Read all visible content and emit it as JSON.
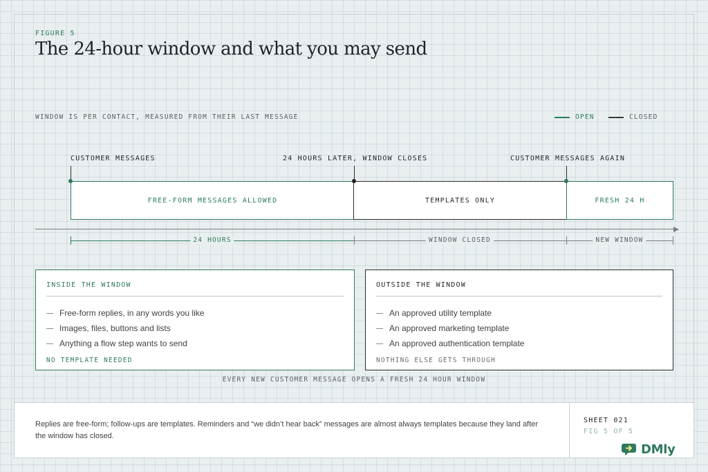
{
  "figure": {
    "label": "FIGURE 5",
    "title": "The 24-hour window and what you may send",
    "subtitle": "WINDOW IS PER CONTACT, MEASURED FROM THEIR LAST MESSAGE"
  },
  "legend": {
    "open": "OPEN",
    "closed": "CLOSED"
  },
  "timeline": {
    "events": [
      "CUSTOMER MESSAGES",
      "24 HOURS LATER, WINDOW CLOSES",
      "CUSTOMER MESSAGES AGAIN"
    ],
    "segments": [
      {
        "label": "FREE-FORM MESSAGES ALLOWED",
        "state": "open"
      },
      {
        "label": "TEMPLATES ONLY",
        "state": "closed"
      },
      {
        "label": "FRESH 24 H",
        "state": "open"
      }
    ],
    "spans": [
      {
        "label": "24 HOURS",
        "state": "open"
      },
      {
        "label": "WINDOW CLOSED",
        "state": "closed"
      },
      {
        "label": "NEW WINDOW",
        "state": "closed"
      }
    ]
  },
  "panels": {
    "inside": {
      "title": "INSIDE THE WINDOW",
      "items": [
        "Free-form replies, in any words you like",
        "Images, files, buttons and lists",
        "Anything a flow step wants to send"
      ],
      "footer": "NO TEMPLATE NEEDED"
    },
    "outside": {
      "title": "OUTSIDE THE WINDOW",
      "items": [
        "An approved utility template",
        "An approved marketing template",
        "An approved authentication template"
      ],
      "footer": "NOTHING ELSE GETS THROUGH"
    }
  },
  "caption": "EVERY NEW CUSTOMER MESSAGE OPENS A FRESH 24 HOUR WINDOW",
  "footer": {
    "note": "Replies are free-form; follow-ups are templates. Reminders and “we didn’t hear back” messages are almost always templates because they land after the window has closed.",
    "sheet": "SHEET 021",
    "figure_ref": "FIG 5 OF 5",
    "logo_text": "DMly",
    "logo_icon": "chat-bubble-arrow-icon"
  },
  "colors": {
    "accent_green": "#2e7a5c",
    "closed_dark": "#2a2a2a",
    "background": "#e9eef0",
    "muted_green": "#8fb8a3"
  }
}
